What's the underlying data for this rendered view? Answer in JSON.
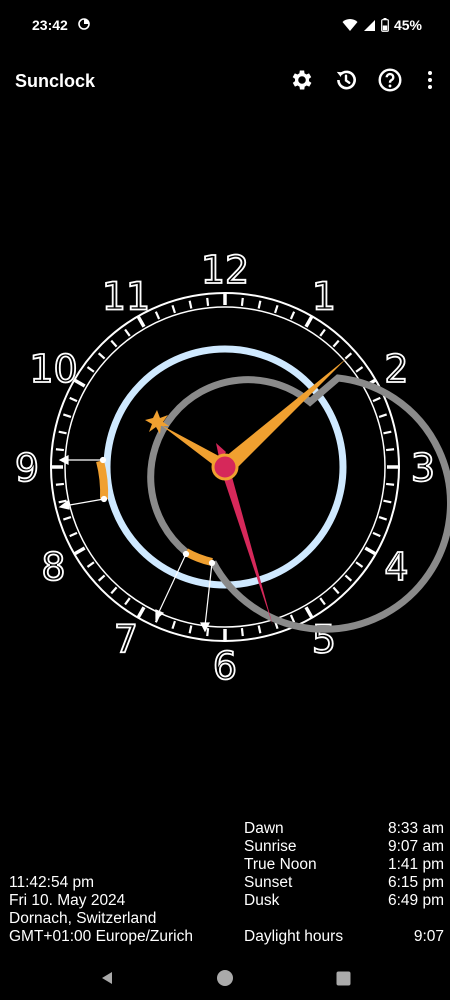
{
  "status": {
    "time": "23:42",
    "battery": "45%",
    "icons": [
      "alarm-icon",
      "wifi-icon",
      "signal-icon",
      "battery-icon"
    ]
  },
  "app": {
    "title": "Sunclock",
    "actions": [
      "settings-gear-icon",
      "history-icon",
      "help-icon",
      "more-options-icon"
    ]
  },
  "clock": {
    "hour_numerals": [
      "12",
      "1",
      "2",
      "3",
      "4",
      "5",
      "6",
      "7",
      "8",
      "9",
      "10",
      "11"
    ],
    "colors": {
      "day_arc": "#cfe9ff",
      "night_arc": "#8a8a8a",
      "twilight": "#f0a030",
      "hands": "#f0a030",
      "second_hand": "#d6285a"
    }
  },
  "location": {
    "time": "11:42:54 pm",
    "date": "Fri 10. May 2024",
    "place": "Dornach, Switzerland",
    "timezone": "GMT+01:00 Europe/Zurich"
  },
  "sun_times": [
    {
      "label": "Dawn",
      "value": "8:33 am"
    },
    {
      "label": "Sunrise",
      "value": "9:07 am"
    },
    {
      "label": "True Noon",
      "value": "1:41 pm"
    },
    {
      "label": "Sunset",
      "value": "6:15 pm"
    },
    {
      "label": "Dusk",
      "value": "6:49 pm"
    }
  ],
  "daylight": {
    "label": "Daylight hours",
    "value": "9:07"
  },
  "nav": [
    "back-icon",
    "home-icon",
    "recents-icon"
  ]
}
